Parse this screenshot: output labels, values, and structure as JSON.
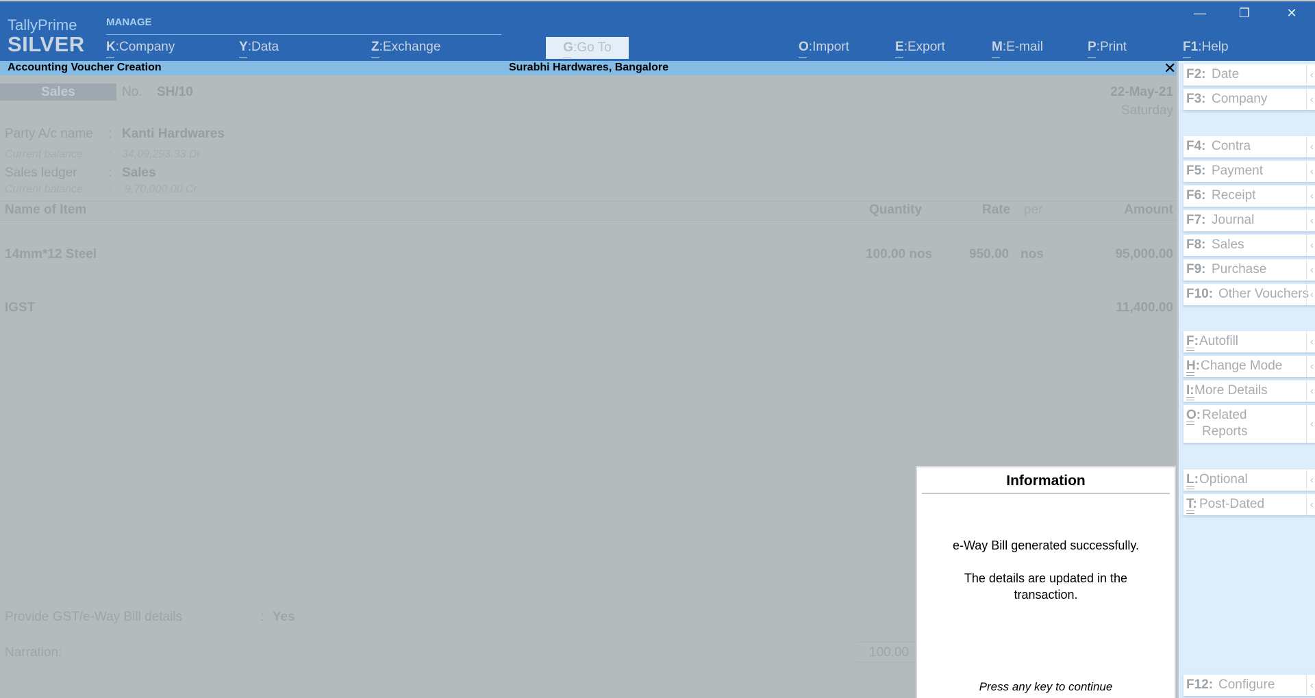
{
  "app": {
    "name": "TallyPrime",
    "edition": "SILVER"
  },
  "topbar": {
    "section_label": "MANAGE",
    "menu": [
      {
        "key": "K",
        "label": "Company"
      },
      {
        "key": "Y",
        "label": "Data"
      },
      {
        "key": "Z",
        "label": "Exchange"
      }
    ],
    "goto": {
      "key": "G",
      "label": "Go To"
    },
    "actions": [
      {
        "key": "O",
        "label": "Import"
      },
      {
        "key": "E",
        "label": "Export"
      },
      {
        "key": "M",
        "label": "E-mail"
      },
      {
        "key": "P",
        "label": "Print"
      },
      {
        "key": "F1",
        "label": "Help"
      }
    ],
    "window_controls": {
      "minimize": "—",
      "restore": "❐",
      "close": "✕"
    }
  },
  "titlebar": {
    "screen_title": "Accounting Voucher Creation",
    "company": "Surabhi Hardwares, Bangalore",
    "close": "✕"
  },
  "voucher": {
    "type": "Sales",
    "number_label": "No.",
    "number": "SH/10",
    "date": "22-May-21",
    "day": "Saturday",
    "party_label": "Party A/c name",
    "party": "Kanti Hardwares",
    "party_balance_label": "Current balance",
    "party_balance": "34,09,293.33 Dr",
    "sales_ledger_label": "Sales ledger",
    "sales_ledger": "Sales",
    "sales_balance_label": "Current balance",
    "sales_balance": "9,70,000.00 Cr",
    "colon": ":",
    "columns": {
      "item": "Name of Item",
      "quantity": "Quantity",
      "rate": "Rate",
      "per": "per",
      "amount": "Amount"
    },
    "items": [
      {
        "name": "14mm*12 Steel",
        "quantity": "100.00 nos",
        "rate": "950.00",
        "per": "nos",
        "amount": "95,000.00"
      }
    ],
    "tax_lines": [
      {
        "name": "IGST",
        "amount": "11,400.00"
      }
    ],
    "gst_label": "Provide GST/e-Way Bill details",
    "gst_value": "Yes",
    "narration_label": "Narration:",
    "total_quantity": "100.00"
  },
  "dialog": {
    "title": "Information",
    "message_1": "e-Way Bill generated successfully.",
    "message_2a": "The details are updated in the",
    "message_2b": "transaction.",
    "footer": "Press any key to continue"
  },
  "right_panel": {
    "chevron": "‹",
    "buttons": [
      {
        "key": "F2:",
        "label": "Date"
      },
      {
        "key": "F3:",
        "label": "Company"
      },
      {
        "key": "F4:",
        "label": "Contra"
      },
      {
        "key": "F5:",
        "label": "Payment"
      },
      {
        "key": "F6:",
        "label": "Receipt"
      },
      {
        "key": "F7:",
        "label": "Journal"
      },
      {
        "key": "F8:",
        "label": "Sales"
      },
      {
        "key": "F9:",
        "label": "Purchase"
      },
      {
        "key": "F10:",
        "label": "Other Vouchers"
      },
      {
        "key": "F:",
        "label": "Autofill"
      },
      {
        "key": "H:",
        "label": "Change Mode"
      },
      {
        "key": "I:",
        "label": "More Details"
      },
      {
        "key": "O:",
        "label": "Related",
        "label2": "Reports"
      },
      {
        "key": "L:",
        "label": "Optional"
      },
      {
        "key": "T:",
        "label": "Post-Dated"
      },
      {
        "key": "F12:",
        "label": "Configure"
      }
    ]
  },
  "colors": {
    "topbar": "#2b67b3",
    "titlebar": "#85bce6",
    "main_bg": "#b4bbbd",
    "panel_bg": "#dcedfb"
  }
}
